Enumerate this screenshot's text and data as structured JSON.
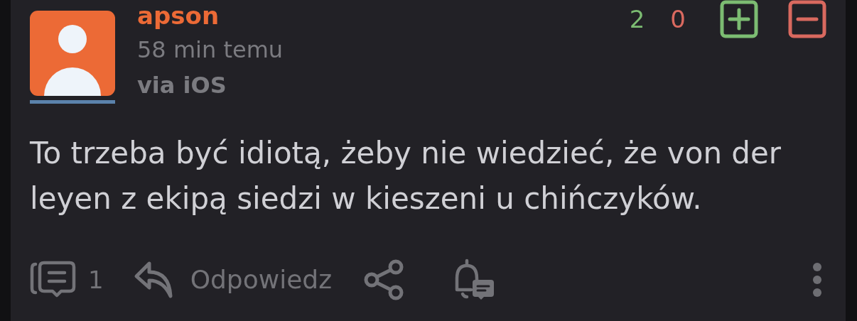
{
  "comment": {
    "author": "apson",
    "time": "58 min temu",
    "via": "via iOS",
    "votes": {
      "up": "2",
      "down": "0"
    },
    "body": "To trzeba być idiotą, żeby nie wiedzieć, że von der leyen z ekipą siedzi w kieszeni u chińczyków.",
    "actions": {
      "comment_count": "1",
      "reply": "Odpowiedz"
    }
  }
}
